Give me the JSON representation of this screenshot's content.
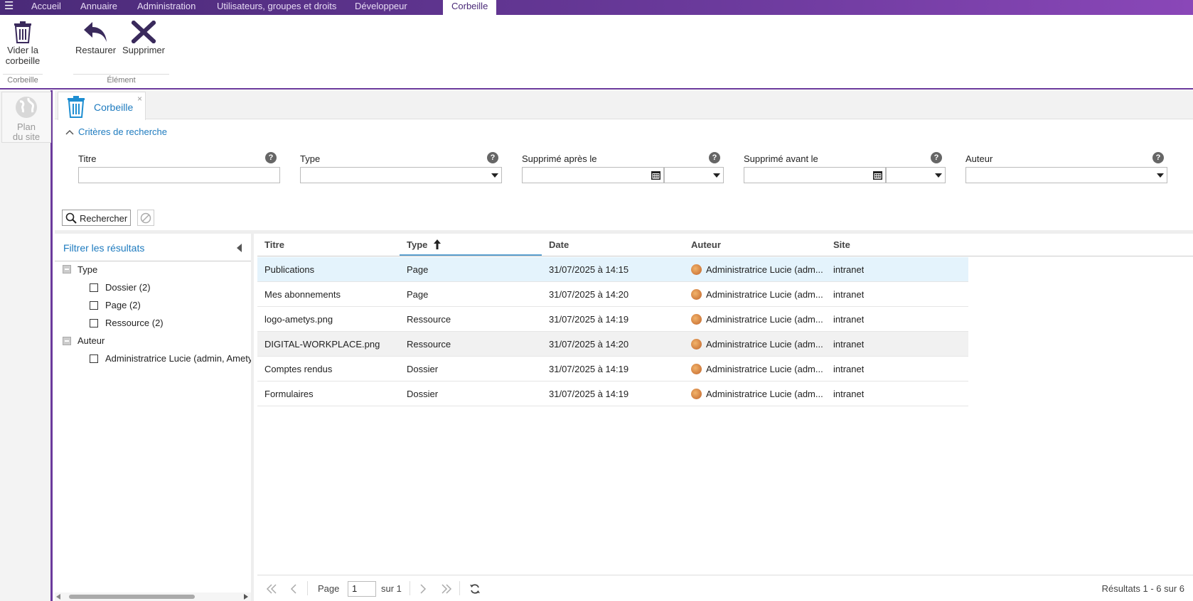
{
  "topbar": {
    "tabs": [
      "Accueil",
      "Annuaire",
      "Administration",
      "Utilisateurs, groupes et droits",
      "Développeur",
      "Corbeille"
    ]
  },
  "ribbon": {
    "empty_trash_label": "Vider la corbeille",
    "empty_trash_line1": "Vider la",
    "empty_trash_line2": "corbeille",
    "restore_label": "Restaurer",
    "delete_label": "Supprimer",
    "group_trash": "Corbeille",
    "group_element": "Élément"
  },
  "leftstrip": {
    "sitemap_line1": "Plan",
    "sitemap_line2": "du site"
  },
  "tab": {
    "label": "Corbeille",
    "close": "×"
  },
  "criteria": {
    "toggle_label": "Critères de recherche",
    "fields": {
      "title": {
        "label": "Titre",
        "value": ""
      },
      "type": {
        "label": "Type",
        "value": ""
      },
      "deleted_after": {
        "label": "Supprimé après le",
        "value": ""
      },
      "deleted_before": {
        "label": "Supprimé avant le",
        "value": ""
      },
      "author": {
        "label": "Auteur",
        "value": ""
      }
    },
    "help": "?",
    "search_label": "Rechercher"
  },
  "filter": {
    "title": "Filtrer les résultats",
    "groups": [
      {
        "label": "Type",
        "items": [
          "Dossier (2)",
          "Page (2)",
          "Ressource (2)"
        ]
      },
      {
        "label": "Auteur",
        "items": [
          "Administratrice Lucie (admin, Ametys"
        ]
      }
    ]
  },
  "grid": {
    "columns": [
      "Titre",
      "Type",
      "Date",
      "Auteur",
      "Site"
    ],
    "sort_arrow": "🠕",
    "rows": [
      {
        "title": "Publications",
        "type": "Page",
        "date": "31/07/2025 à 14:15",
        "author": "Administratrice Lucie (adm...",
        "site": "intranet",
        "state": "selected"
      },
      {
        "title": "Mes abonnements",
        "type": "Page",
        "date": "31/07/2025 à 14:20",
        "author": "Administratrice Lucie (adm...",
        "site": "intranet",
        "state": ""
      },
      {
        "title": "logo-ametys.png",
        "type": "Ressource",
        "date": "31/07/2025 à 14:19",
        "author": "Administratrice Lucie (adm...",
        "site": "intranet",
        "state": ""
      },
      {
        "title": "DIGITAL-WORKPLACE.png",
        "type": "Ressource",
        "date": "31/07/2025 à 14:20",
        "author": "Administratrice Lucie (adm...",
        "site": "intranet",
        "state": "alt"
      },
      {
        "title": "Comptes rendus",
        "type": "Dossier",
        "date": "31/07/2025 à 14:19",
        "author": "Administratrice Lucie (adm...",
        "site": "intranet",
        "state": ""
      },
      {
        "title": "Formulaires",
        "type": "Dossier",
        "date": "31/07/2025 à 14:19",
        "author": "Administratrice Lucie (adm...",
        "site": "intranet",
        "state": ""
      }
    ]
  },
  "pager": {
    "page_label": "Page",
    "page_value": "1",
    "of_label": "sur 1",
    "results": "Résultats 1 - 6 sur 6"
  }
}
